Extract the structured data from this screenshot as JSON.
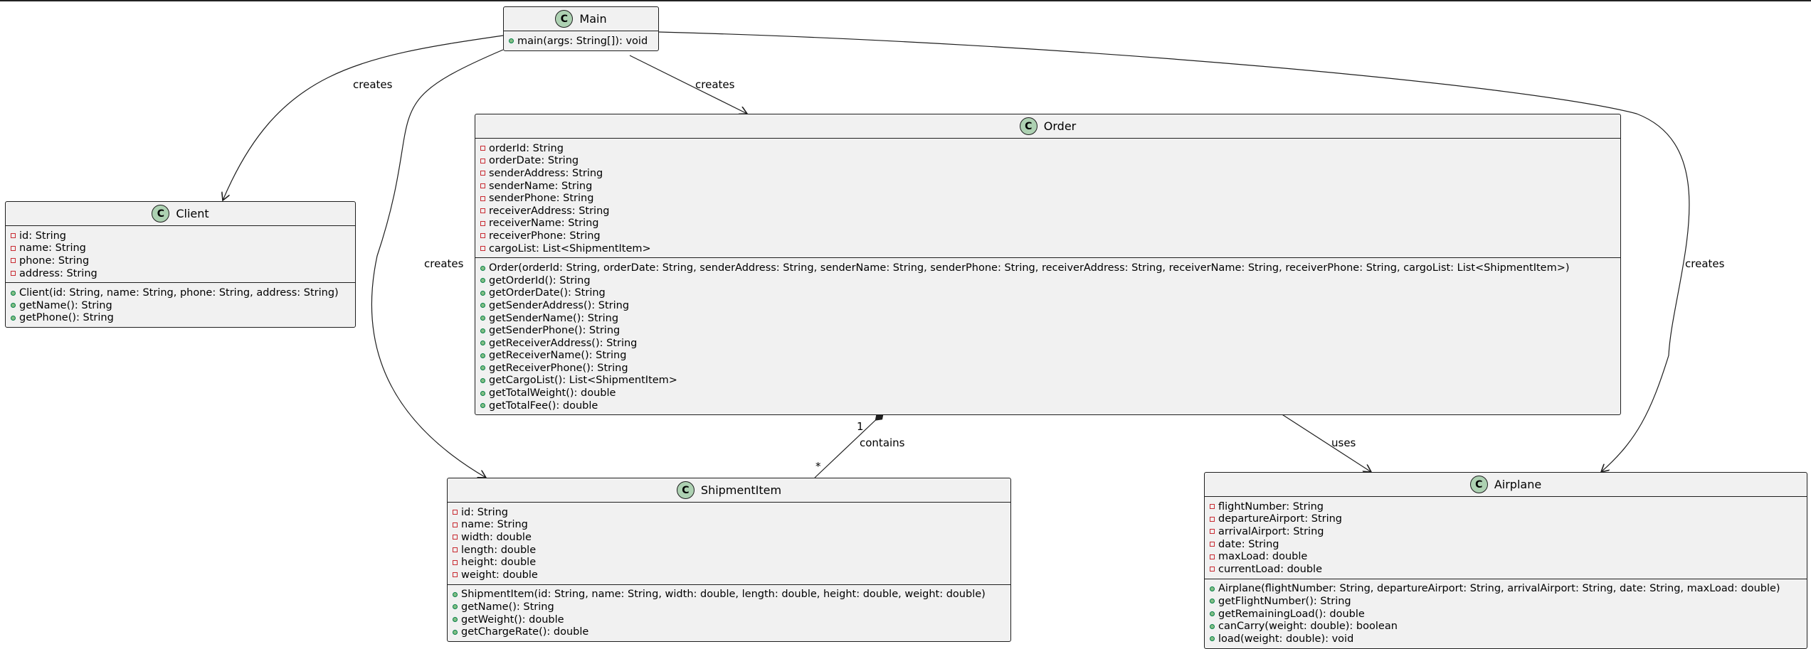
{
  "classes": {
    "main": {
      "name": "Main",
      "badge": "C",
      "fields": [],
      "methods": [
        "main(args: String[]): void"
      ]
    },
    "client": {
      "name": "Client",
      "badge": "C",
      "fields": [
        "id: String",
        "name: String",
        "phone: String",
        "address: String"
      ],
      "methods": [
        "Client(id: String, name: String, phone: String, address: String)",
        "getName(): String",
        "getPhone(): String"
      ]
    },
    "order": {
      "name": "Order",
      "badge": "C",
      "fields": [
        "orderId: String",
        "orderDate: String",
        "senderAddress: String",
        "senderName: String",
        "senderPhone: String",
        "receiverAddress: String",
        "receiverName: String",
        "receiverPhone: String",
        "cargoList: List<ShipmentItem>"
      ],
      "methods": [
        "Order(orderId: String, orderDate: String, senderAddress: String, senderName: String, senderPhone: String, receiverAddress: String, receiverName: String, receiverPhone: String, cargoList: List<ShipmentItem>)",
        "getOrderId(): String",
        "getOrderDate(): String",
        "getSenderAddress(): String",
        "getSenderName(): String",
        "getSenderPhone(): String",
        "getReceiverAddress(): String",
        "getReceiverName(): String",
        "getReceiverPhone(): String",
        "getCargoList(): List<ShipmentItem>",
        "getTotalWeight(): double",
        "getTotalFee(): double"
      ]
    },
    "shipment": {
      "name": "ShipmentItem",
      "badge": "C",
      "fields": [
        "id: String",
        "name: String",
        "width: double",
        "length: double",
        "height: double",
        "weight: double"
      ],
      "methods": [
        "ShipmentItem(id: String, name: String, width: double, length: double, height: double, weight: double)",
        "getName(): String",
        "getWeight(): double",
        "getChargeRate(): double"
      ]
    },
    "airplane": {
      "name": "Airplane",
      "badge": "C",
      "fields": [
        "flightNumber: String",
        "departureAirport: String",
        "arrivalAirport: String",
        "date: String",
        "maxLoad: double",
        "currentLoad: double"
      ],
      "methods": [
        "Airplane(flightNumber: String, departureAirport: String, arrivalAirport: String, date: String, maxLoad: double)",
        "getFlightNumber(): String",
        "getRemainingLoad(): double",
        "canCarry(weight: double): boolean",
        "load(weight: double): void"
      ]
    }
  },
  "relations": {
    "main_client": "creates",
    "main_shipment": "creates",
    "main_order": "creates",
    "main_airplane": "creates",
    "order_shipment": "contains",
    "order_shipment_mult_order": "1",
    "order_shipment_mult_item": "*",
    "order_airplane": "uses"
  },
  "colors": {
    "class_fill": "#f1f1f1",
    "badge_fill": "#add1b2",
    "private_marker": "#c82930",
    "public_marker": "#84be84"
  }
}
